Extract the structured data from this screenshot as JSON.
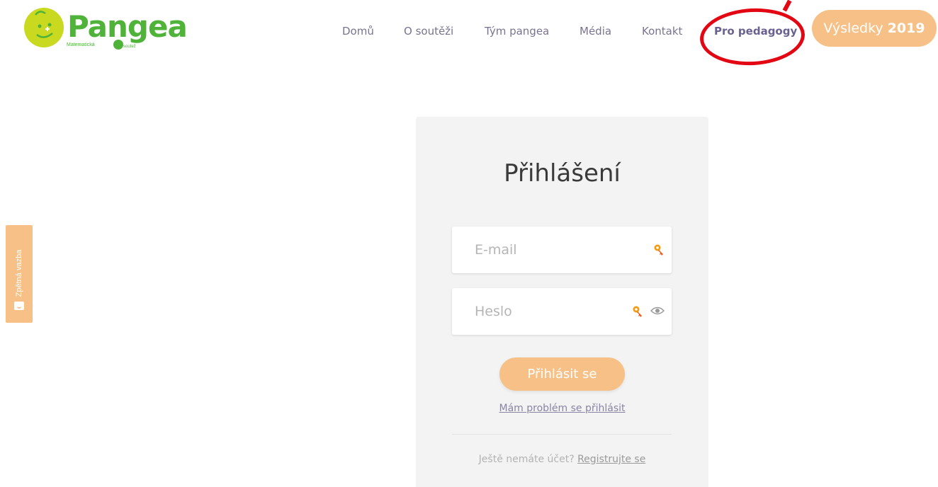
{
  "header": {
    "logo": {
      "name": "Pangea",
      "tagline_left": "Matematická",
      "tagline_right": "soutež"
    },
    "nav": [
      {
        "label": "Domů",
        "active": false
      },
      {
        "label": "O soutěži",
        "active": false
      },
      {
        "label": "Tým pangea",
        "active": false
      },
      {
        "label": "Média",
        "active": false
      },
      {
        "label": "Kontakt",
        "active": false
      },
      {
        "label": "Pro pedagogy",
        "active": true
      }
    ],
    "results_button": {
      "text": "Výsledky",
      "year": "2019"
    }
  },
  "feedback_tab": {
    "label": "Zpětná vazba",
    "icon": "feedback-face-icon"
  },
  "login": {
    "title": "Přihlášení",
    "email": {
      "placeholder": "E-mail",
      "value": "",
      "icon": "key-icon"
    },
    "password": {
      "placeholder": "Heslo",
      "value": "",
      "icons": [
        "key-icon",
        "eye-icon"
      ]
    },
    "submit_label": "Přihlásit se",
    "problem_link": "Mám problém se přihlásit",
    "register_prompt": "Ještě nemáte účet?",
    "register_link": "Registrujte se"
  },
  "colors": {
    "accent": "#f6c086",
    "nav_text": "#7a7390",
    "annotation_ring": "#e30613",
    "logo_green": "#4fb33a",
    "logo_yellow": "#c9d91f"
  }
}
